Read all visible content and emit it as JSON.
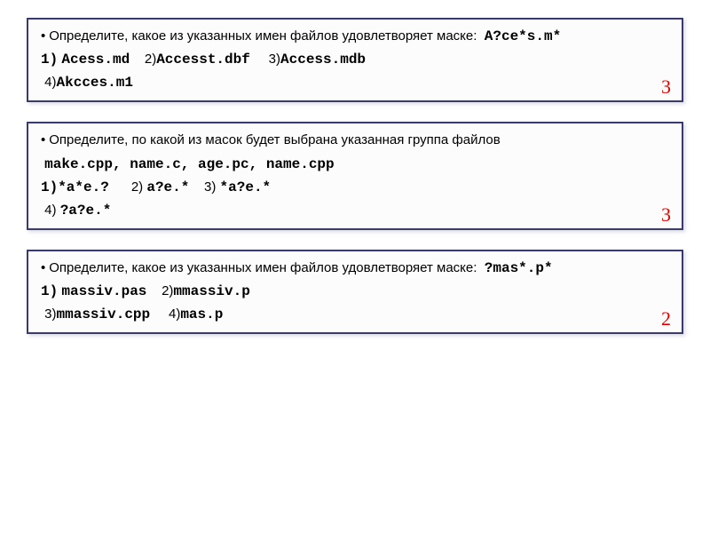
{
  "q1": {
    "prompt_pre": "Определите, какое из указанных имен файлов удовлетворяет маске:",
    "mask": "A?ce*s.m*",
    "opts": {
      "l1": "1)",
      "v1": "Acess.md",
      "l2": "2)",
      "v2": "Accesst.dbf",
      "l3": "3)",
      "v3": "Access.mdb",
      "l4": "4)",
      "v4": "Akcces.m1"
    },
    "answer": "3"
  },
  "q2": {
    "prompt_pre": "Определите, по какой из масок будет выбрана указанная группа файлов",
    "files": "make.cpp, name.c, age.pc, name.cpp",
    "opts": {
      "l1": "1)",
      "v1": "*a*e.?",
      "l2": "2)",
      "v2": "a?e.*",
      "l3": "3)",
      "v3": "*a?e.*",
      "l4": "4)",
      "v4": "?a?e.*"
    },
    "answer": "3"
  },
  "q3": {
    "prompt_pre": "Определите, какое из указанных имен файлов удовлетворяет маске:",
    "mask": "?mas*.p*",
    "opts": {
      "l1": "1)",
      "v1": "massiv.pas",
      "l2": "2)",
      "v2": "mmassiv.p",
      "l3": "3)",
      "v3": "mmassiv.cpp",
      "l4": "4)",
      "v4": "mas.p"
    },
    "answer": "2"
  }
}
